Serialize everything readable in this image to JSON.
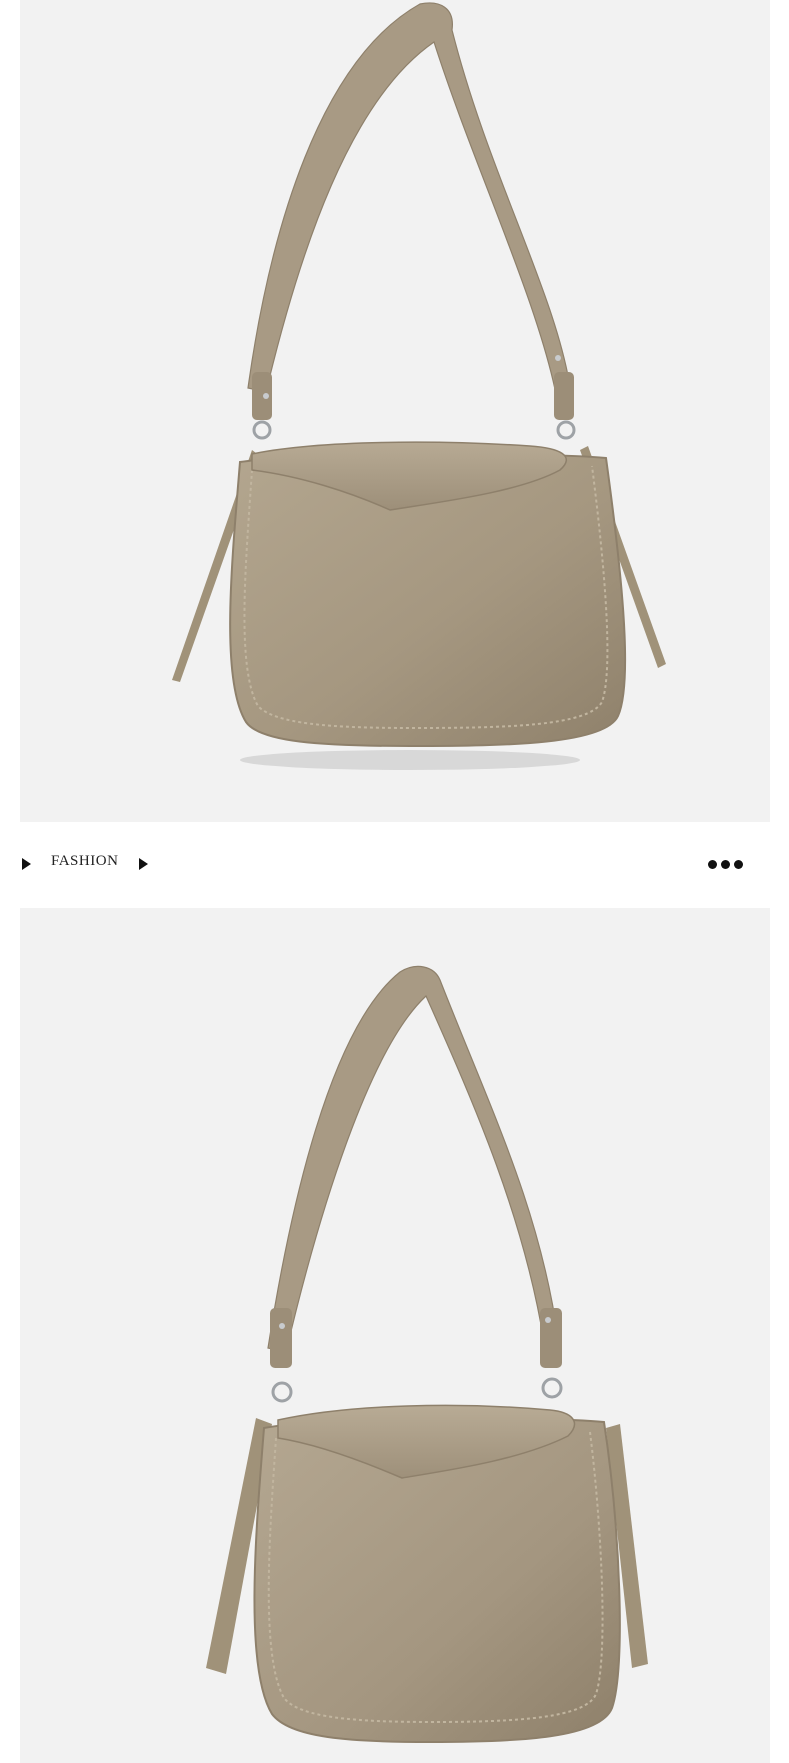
{
  "colors": {
    "panel_background": "#f2f2f2",
    "leather": "#a89a84",
    "leather_dark": "#8e806b",
    "leather_light": "#b9ac97",
    "hardware": "#9ea2a6",
    "icon": "#111111"
  },
  "panels": [
    {
      "subject": "taupe-leather-shoulder-bag-front"
    },
    {
      "subject": "taupe-leather-shoulder-bag-angled"
    }
  ],
  "divider": {
    "label": "FASHION",
    "left_icon": "play-arrow-icon",
    "right_icon": "play-arrow-icon",
    "menu_icon": "more-dots-icon"
  }
}
